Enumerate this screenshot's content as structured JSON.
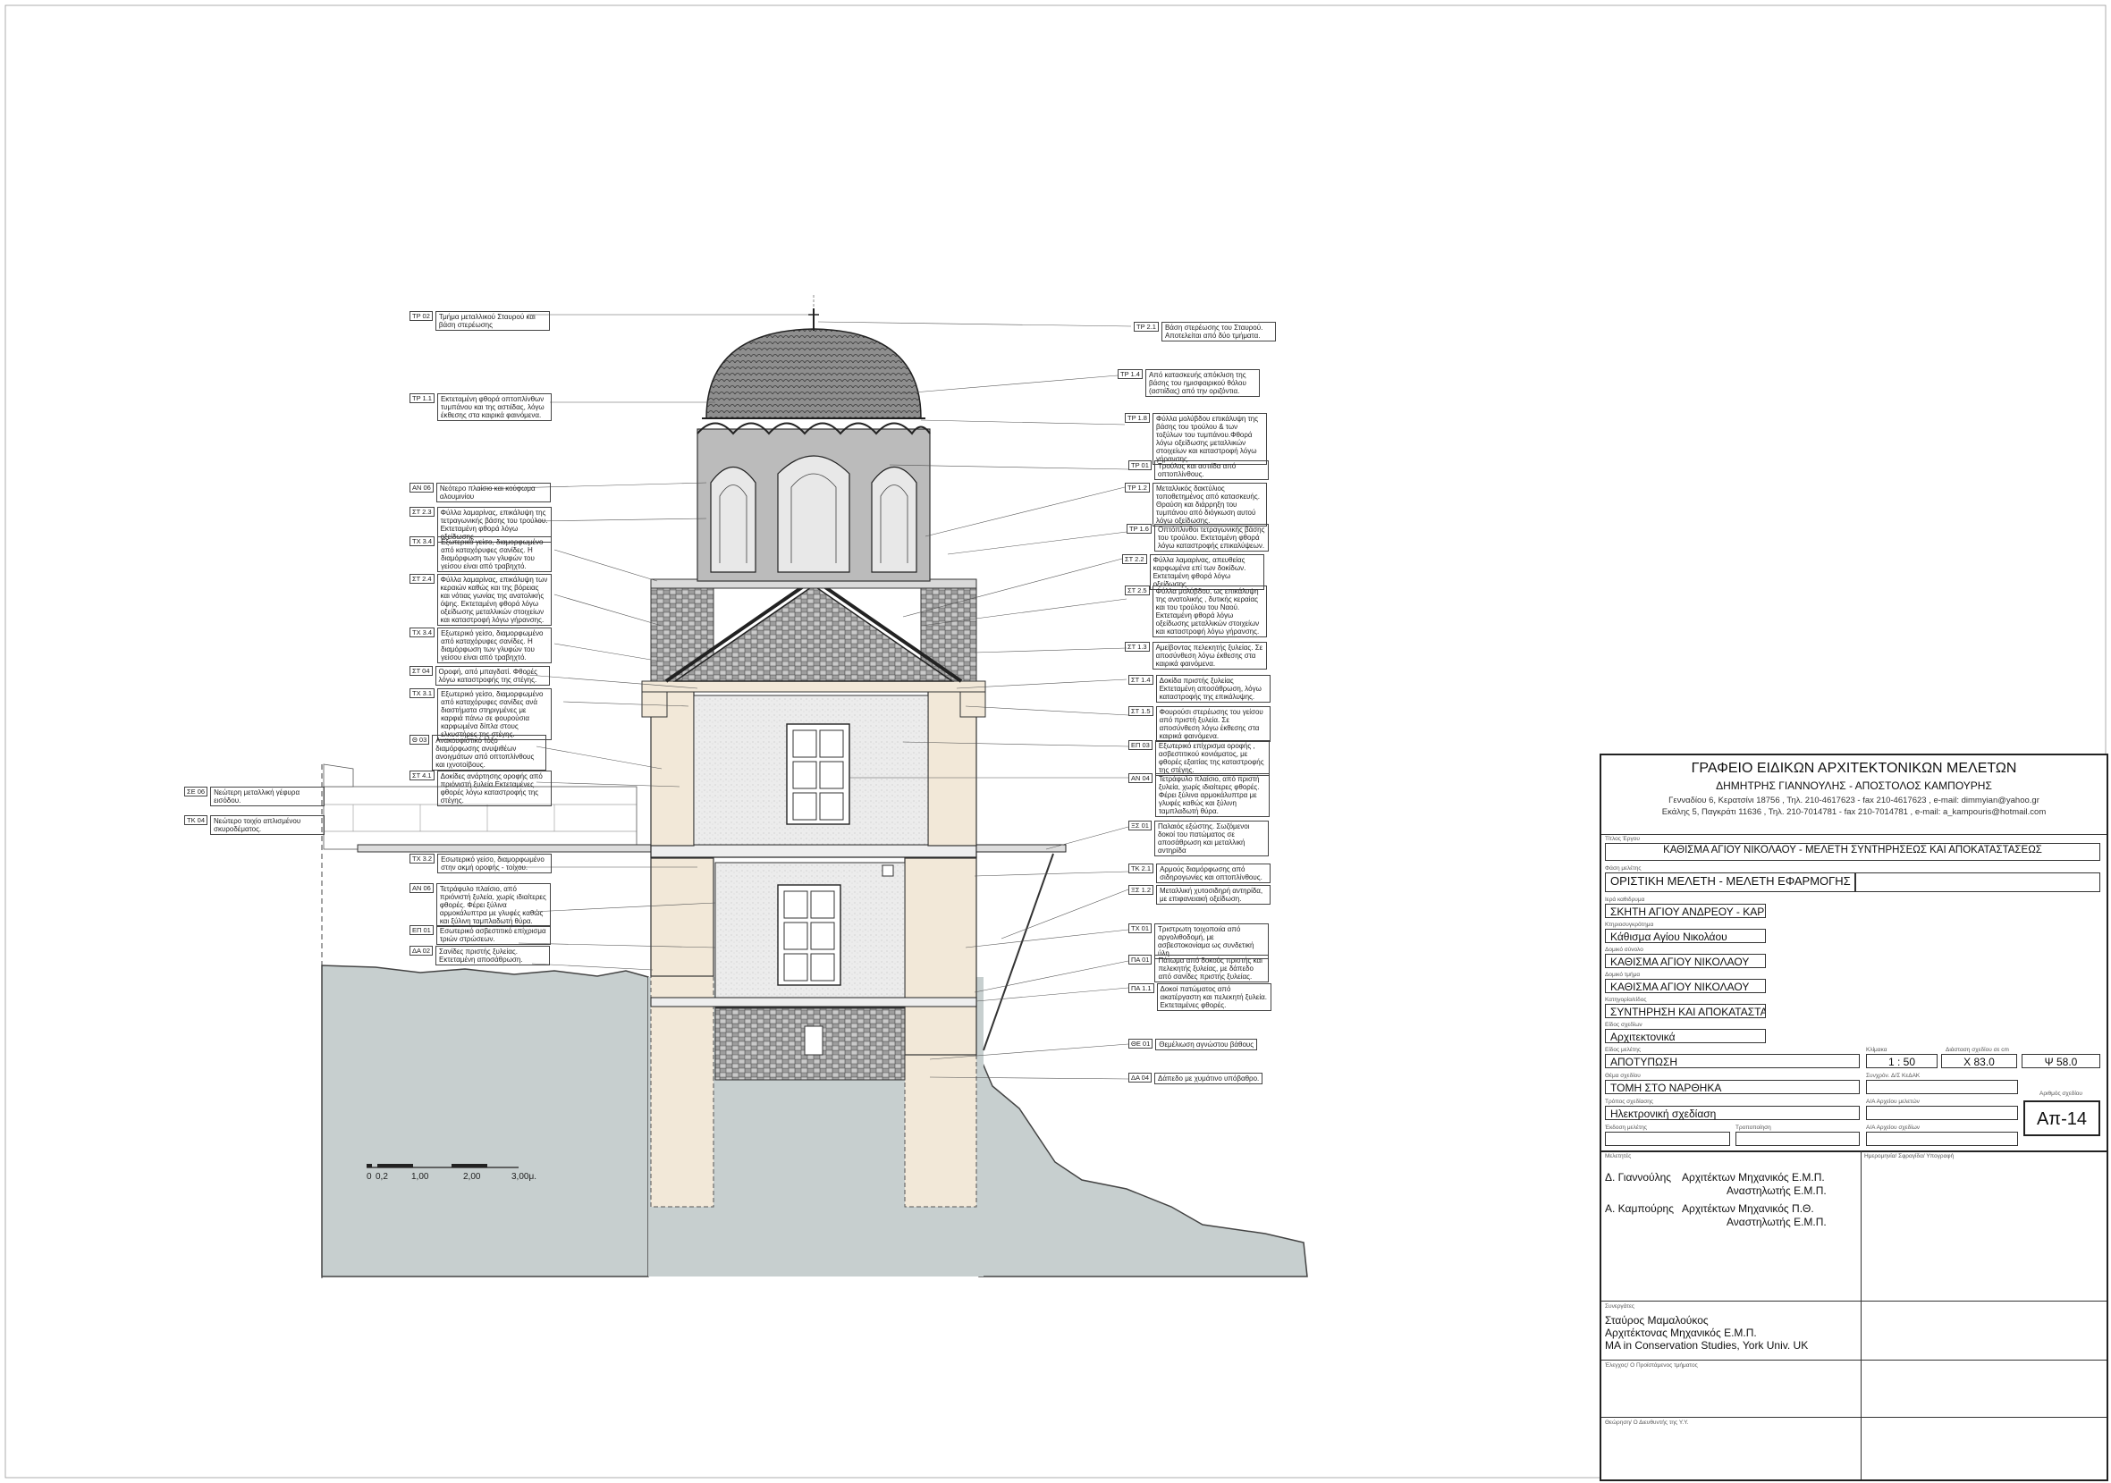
{
  "office": {
    "title": "ΓΡΑΦΕΙΟ ΕΙΔΙΚΩΝ ΑΡΧΙΤΕΚΤΟΝΙΚΩΝ ΜΕΛΕΤΩΝ",
    "partners": "ΔΗΜΗΤΡΗΣ ΓΙΑΝΝΟΥΛΗΣ  -  ΑΠΟΣΤΟΛΟΣ ΚΑΜΠΟΥΡΗΣ",
    "address1": "Γενναδίου 6, Κερατσίνι 18756 , Τηλ. 210-4617623 - fax 210-4617623 , e-mail: dimmyian@yahoo.gr",
    "address2": "Εκάλης 5, Παγκράτι 11636 , Τηλ. 210-7014781 - fax 210-7014781 , e-mail: a_kampouris@hotmail.com"
  },
  "titleblock": {
    "project_label": "Τίτλος Έργου",
    "project": "ΚΑΘΙΣΜΑ ΑΓΙΟΥ ΝΙΚΟΛΑΟΥ - ΜΕΛΕΤΗ ΣΥΝΤΗΡΗΣΕΩΣ ΚΑΙ ΑΠΟΚΑΤΑΣΤΑΣΕΩΣ",
    "phase_label": "Φάση μελέτης",
    "phase": "ΟΡΙΣΤΙΚΗ ΜΕΛΕΤΗ - ΜΕΛΕΤΗ ΕΦΑΡΜΟΓΗΣ",
    "monastery_label": "Ιερά καθιδρυμα",
    "monastery": "ΣΚΗΤΗ ΑΓΙΟΥ ΑΝΔΡΕΟΥ - ΚΑΡΥΕΣ",
    "complex_label": "Κτηριοσυγκρότημα",
    "complex": "Κάθισμα Αγίου Νικολάου",
    "building_label": "Δομικό σύνολο",
    "building": "ΚΑΘΙΣΜΑ ΑΓΙΟΥ ΝΙΚΟΛΑΟΥ",
    "part_label": "Δομικό τμήμα",
    "part": "ΚΑΘΙΣΜΑ ΑΓΙΟΥ ΝΙΚΟΛΑΟΥ",
    "category_label": "Κατηγορία/είδος",
    "category": "ΣΥΝΤΗΡΗΣΗ ΚΑΙ ΑΠΟΚΑΤΑΣΤΑΣΗ",
    "drawing_type_label": "Είδος σχεδίων",
    "drawing_type": "Αρχιτεκτονικά",
    "study_type_label": "Είδος μελέτης",
    "study_type": "ΑΠΟΤΥΠΩΣΗ",
    "scale_label": "Κλίμακα",
    "scale": "1 : 50",
    "dims_label": "Διάσταση σχεδίου σε cm",
    "dim_x": "Χ  83.0",
    "dim_y": "Ψ  58.0",
    "section_label": "Θέμα σχεδίου",
    "section": "ΤΟΜΗ ΣΤΟ ΝΑΡΘΗΚΑ",
    "method_label": "Τρόπος σχεδίασης",
    "method": "Ηλεκτρονική σχεδίαση",
    "scale_ref_label": "Συνχρόν. Δ/Σ ΚεΔΑΚ",
    "archive_label": "Α/Α Αρχείου μελετών",
    "archive2_label": "Α/Α Αρχείου σχεδίων",
    "issue_label": "Έκδοση μελέτης",
    "revision_label": "Τροποποίηση",
    "drawing_no_label": "Αριθμός σχεδίου",
    "drawing_no": "Απ-14",
    "designers_label": "Μελετητές",
    "designer1": "Δ. Γιαννούλης",
    "designer1_title1": "Αρχιτέκτων Μηχανικός Ε.Μ.Π.",
    "designer1_title2": "Αναστηλωτής Ε.Μ.Π.",
    "designer2": "Α. Καμπούρης",
    "designer2_title1": "Αρχιτέκτων Μηχανικός Π.Θ.",
    "designer2_title2": "Αναστηλωτής Ε.Μ.Π.",
    "signature_label": "Ημερομηνία/ Σφραγίδα/ Υπογραφή",
    "collab_label": "Συνεργάτες",
    "collab1": "Σταύρος  Μαμαλούκος",
    "collab2": "Αρχιτέκτονας Μηχανικός Ε.Μ.Π.",
    "collab3": "MA in Conservation Studies, York Univ. UK",
    "check_label": "Έλεγχος/ Ο Προϊστάμενος τμήματος",
    "approve_label": "Θεώρηση/ Ο Διευθυντής της Υ.Υ."
  },
  "scale_bar": [
    "0",
    "0,2",
    "1,00",
    "2,00",
    "3,00μ."
  ],
  "annotations_left": [
    {
      "code": "ΤΡ  02",
      "text": "Τμήμα μεταλλικού Σταυρού και βάση στερέωσης"
    },
    {
      "code": "ΤΡ  1.1",
      "text": "Εκτεταμένη φθορά οπτοπλίνθων τυμπάνου και της αστιίδας, λόγω έκθεσης στα καιρικά φαινόμενα."
    },
    {
      "code": "ΑΝ  06",
      "text": "Νεότερο πλαίσιο και κούφωμα αλουμινίου"
    },
    {
      "code": "ΣΤ  2.3",
      "text": "Φύλλα λαμαρίνας, επικάλυψη της τετραγωνικής βάσης του τρούλου. Εκτεταμένη φθορά λόγω οξείδωσης"
    },
    {
      "code": "ΤΧ  3.4",
      "text": "Εξωτερικό γείσο, διαμορφωμένο από καταχόρυφες σανίδες. Η διαμόρφωση των γλυφών του γείσου είναι από τραβηχτό."
    },
    {
      "code": "ΣΤ  2.4",
      "text": "Φύλλα λαμαρίνας, επικάλυψη των κεραιών καθώς και της βόρειας και νότιας γωνίας της ανατολικής όψης. Εκτεταμένη φθορά λόγω οξείδωσης μεταλλικών στοιχείων και καταστροφή λόγω γήρανσης."
    },
    {
      "code": "ΤΧ  3.4",
      "text": "Εξωτερικό γείσο, διαμορφωμένο από καταχόρυφες σανίδες. Η διαμόρφωση των γλυφών του γείσου είναι από τραβηχτό."
    },
    {
      "code": "ΣΤ  04",
      "text": "Οροφή, από μπαγδατί. Φθορές λόγω καταστροφής της στέγης."
    },
    {
      "code": "ΤΧ  3.1",
      "text": "Εξωτερικό γείσο, διαμορφωμένο από καταχόρυφες σανίδες ανά διαστήματα στηριγμένες με καρφιά πάνω σε φουρούσια καρφωμένα δίπλα στους ελκυστήρες της στέγης."
    },
    {
      "code": "Θ   03",
      "text": "Ανακουφιστικό τόξο διαμόρφωσης ανυψιθέων ανοιγμάτων από οπτοπλίνθους και ιχνοτοίβους."
    },
    {
      "code": "ΣΤ  4.1",
      "text": "Δοκίδες ανάρτησης οροφής από πριόνιστή ξυλεία.Εκτεταμένες φθορές λόγω καταστροφής της στέγης."
    },
    {
      "code": "ΣΕ  06",
      "text": "Νεώτερη μεταλλική γέφυρα εισόδου."
    },
    {
      "code": "ΤΚ  04",
      "text": "Νεώτερο τοιχίο απλισμένου σκυροδέματος."
    },
    {
      "code": "ΤΧ  3.2",
      "text": "Εσωτερικό γείσο, διαμορφωμένο στην ακμή οροφής - τοίχου."
    },
    {
      "code": "ΑΝ  06",
      "text": "Τετράφυλο πλαίσιο, από πριόνιστή ξυλεία, χωρίς ιδιαίτερες φθορές. Φέρει ξύλινα αρμοκάλυπτρα με γλυφές καθώς και ξύλινη ταμπλαδωτή θύρα."
    },
    {
      "code": "ΕΠ  01",
      "text": "Εσωτερικό ασβεστιτικό επίχρισμα τριών στρώσεων."
    },
    {
      "code": "ΔΑ  02",
      "text": "Σανίδες πριστής ξυλείας. Εκτεταμένη αποσάθρωση."
    }
  ],
  "annotations_right": [
    {
      "code": "ΤΡ  2.1",
      "text": "Βάση στερέωσης του Σταυρού. Αποτελείται από δύο τμήματα."
    },
    {
      "code": "ΤΡ  1.4",
      "text": "Από κατασκευής απόκλιση της βάσης του ημισφαιρικού θόλου (αστιίδας) από την οριζόντια."
    },
    {
      "code": "ΤΡ  1.8",
      "text": "Φύλλα μολύβδου επικάλυψη της βάσης του τρούλου & των τοξύλων του τυμπάνου.Φθορά λόγω οξείδωσης μεταλλικών στοιχείων και καταστροφή λόγω γήρανσης"
    },
    {
      "code": "ΤΡ  01",
      "text": "Τρούλος και αστιίδα από οπτοπλίνθους."
    },
    {
      "code": "ΤΡ  1.2",
      "text": "Μεταλλικός δακτύλιος τοποθετημένος από κατασκευής. Θραύση και διάρρηξη του τυμπάνου από διόγκωση αυτού λόγω οξείδωσης."
    },
    {
      "code": "ΤΡ  1.6",
      "text": "Οπτόπλινθοι τετραγωνικής βάσης του τρούλου. Εκτεταμένη φθορά λόγω καταστροφής επικαλύψεων."
    },
    {
      "code": "ΣΤ  2.2",
      "text": "Φύλλα λαμαρίνας, απευθείας καρφωμένα επί των δοκίδων. Εκτεταμένη φθορά λόγω οξείδωσης."
    },
    {
      "code": "ΣΤ  2.5",
      "text": "Φύλλα μολύβδου, ως επικάλυψη της ανατολικής , δυτικής κεραίας και του τρούλου του Ναού. Εκτεταμένη φθορά λόγω οξείδωσης μεταλλικών στοιχείων και καταστροφή λόγω γήρανσης."
    },
    {
      "code": "ΣΤ  1.3",
      "text": "Αμείβοντας πελεκητής ξυλείας. Σε αποσύνθεση λόγω έκθεσης στα καιρικά φαινόμενα."
    },
    {
      "code": "ΣΤ  1.4",
      "text": "Δοκίδα πριστής ξυλείας Εκτεταμένη αποσάθρωση, λόγω καταστροφής της επικάλυψης."
    },
    {
      "code": "ΣΤ  1.5",
      "text": "Φουρούσι στερέωσης του γείσου από πριστή ξυλεία. Σε αποσύνθεση λόγω έκθεσης στα καιρικά φαινόμενα."
    },
    {
      "code": "ΕΠ  03",
      "text": "Εξωτερικό επίχρισμα οροφής , ασβεστιτικού κονιάματος, με φθορές εξαιτίας της καταστροφής της στέγης."
    },
    {
      "code": "ΑΝ  04",
      "text": "Τετράφυλο πλαίσιο, από πριστή ξυλεία, χωρίς ιδιαίτερες φθορές. Φέρει ξύλινα αρμοκάλυπτρα με γλυφές καθώς και ξύλινη ταμπλαδωτή θύρα."
    },
    {
      "code": "ΞΣ  01",
      "text": "Παλαιός εξώστης. Σωζόμενοι δοκοί του πατώματος σε αποσάθρωση και μεταλλική αντηρίδα"
    },
    {
      "code": "ΤΚ  2.1",
      "text": "Αρμούς διαμόρφωσης από σιδηρογωνίες και οπτοπλίνθους."
    },
    {
      "code": "ΞΣ  1.2",
      "text": "Μεταλλική χυτοσιδηρή αντηρίδα, με επιφανειακή οξείδωση."
    },
    {
      "code": "ΤΧ  01",
      "text": "Τριστρωτη τοιχοποιία από αργολιθοδομή, με ασβεστοκονίαμα ως συνδετική ύλη."
    },
    {
      "code": "ΠΑ  01",
      "text": "Πάτωμα από δοκούς πριστής και πελεκητής ξυλείας, με δάπεδο από σανίδες πριστής ξυλείας."
    },
    {
      "code": "ΠΑ  1.1",
      "text": "Δοκοί πατώματος από ακατέργαστη και πελεκητή ξυλεία. Εκτεταμένες φθορές."
    },
    {
      "code": "ΘΕ  01",
      "text": "Θεμέλιωση αγνώστου βάθους"
    },
    {
      "code": "ΔΑ  04",
      "text": "Δάπεδο με χυμάτινο υπόβαθρο."
    }
  ],
  "colors": {
    "ground": "#c7cfcf",
    "wall_section": "#f2e8d8",
    "stone": "#9a9a9a",
    "line": "#222222"
  }
}
